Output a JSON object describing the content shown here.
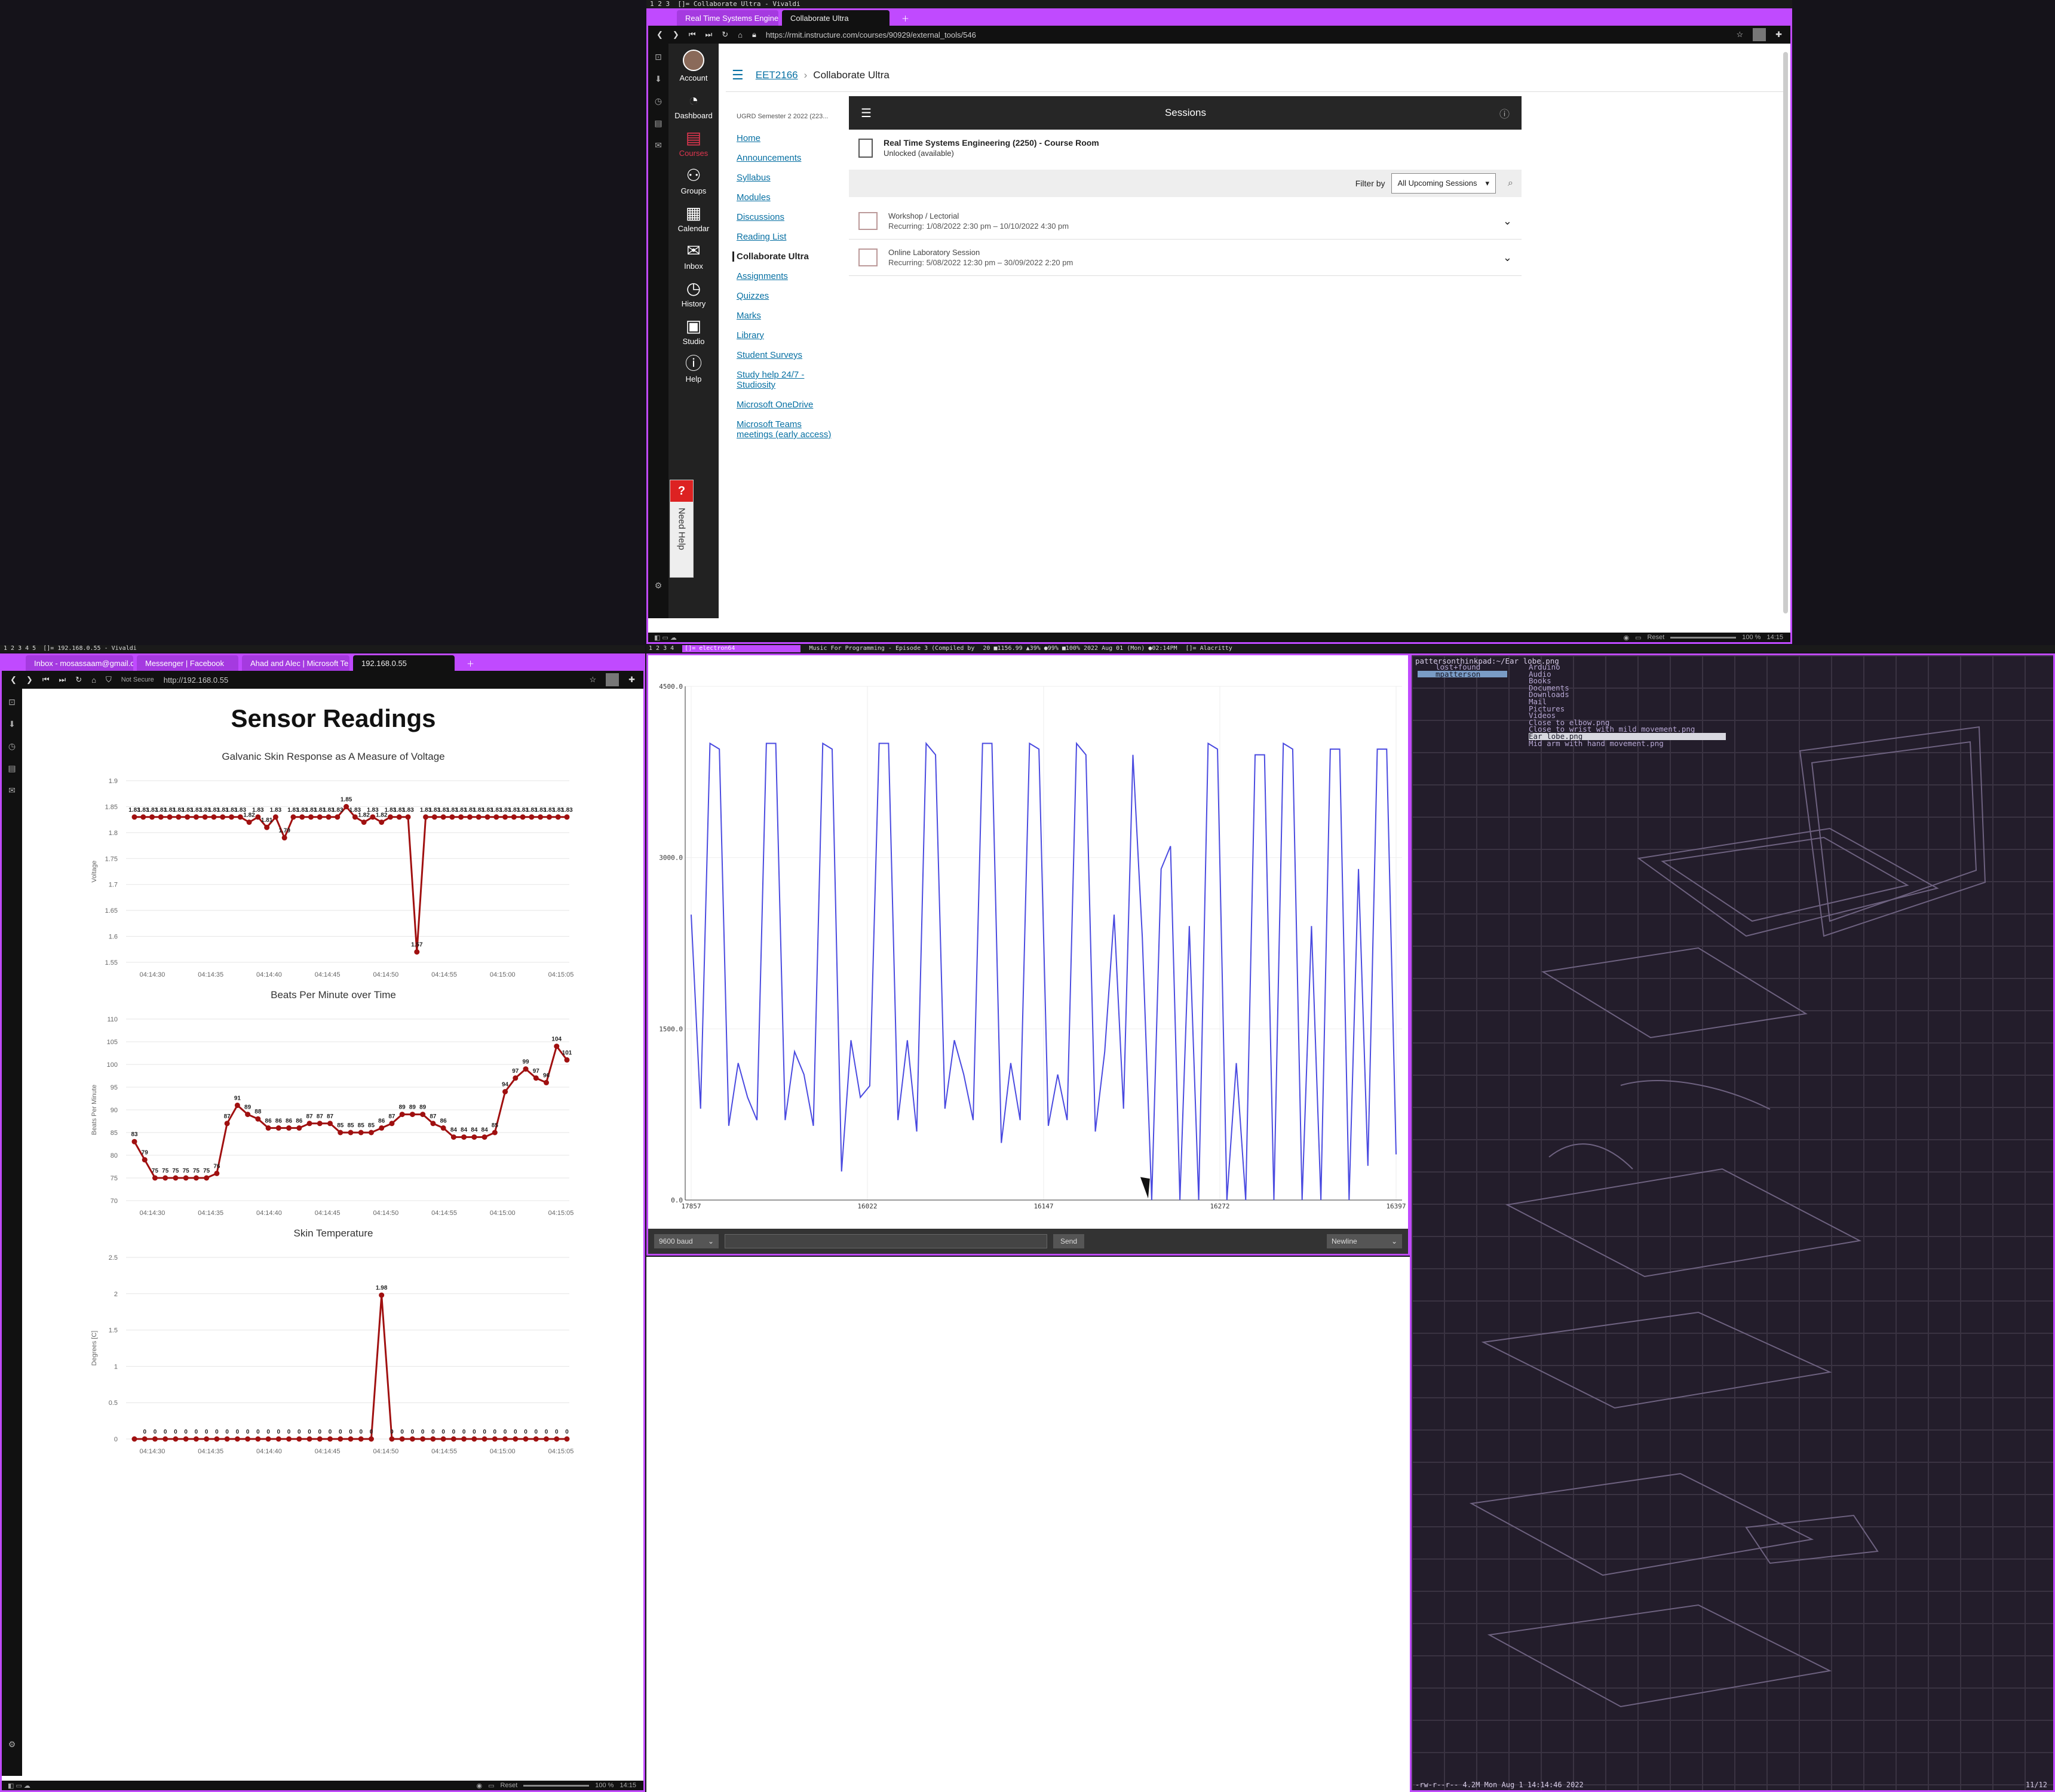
{
  "top_bar": {
    "workspaces": [
      "1",
      "2",
      "3"
    ],
    "title": "[]= Collaborate Ultra - Vivaldi"
  },
  "canvas_browser": {
    "tabs": [
      "Real Time Systems Engineer",
      "Collaborate Ultra"
    ],
    "url": "https://rmit.instructure.com/courses/90929/external_tools/546",
    "global_nav": [
      {
        "label": "Account",
        "icon": "account-icon"
      },
      {
        "label": "Dashboard",
        "icon": "dashboard-icon"
      },
      {
        "label": "Courses",
        "icon": "courses-icon"
      },
      {
        "label": "Groups",
        "icon": "groups-icon"
      },
      {
        "label": "Calendar",
        "icon": "calendar-icon"
      },
      {
        "label": "Inbox",
        "icon": "inbox-icon"
      },
      {
        "label": "History",
        "icon": "history-icon"
      },
      {
        "label": "Studio",
        "icon": "studio-icon"
      },
      {
        "label": "Help",
        "icon": "help-icon"
      }
    ],
    "need_help": "Need Help",
    "breadcrumb": {
      "course": "EET2166",
      "page": "Collaborate Ultra"
    },
    "term": "UGRD Semester 2 2022 (223...",
    "course_nav": [
      "Home",
      "Announcements",
      "Syllabus",
      "Modules",
      "Discussions",
      "Reading List",
      "Collaborate Ultra",
      "Assignments",
      "Quizzes",
      "Marks",
      "Library",
      "Student Surveys",
      "Study help 24/7 - Studiosity",
      "Microsoft OneDrive",
      "Microsoft Teams meetings (early access)"
    ],
    "sessions": {
      "title": "Sessions",
      "room_name": "Real Time Systems Engineering (2250) - Course Room",
      "room_status": "Unlocked (available)",
      "filter_label": "Filter by",
      "filter_value": "All Upcoming Sessions",
      "list": [
        {
          "name": "Workshop / Lectorial",
          "recurring": "Recurring: 1/08/2022 2:30 pm – 10/10/2022 4:30 pm"
        },
        {
          "name": "Online Laboratory Session",
          "recurring": "Recurring: 5/08/2022 12:30 pm – 30/09/2022 2:20 pm"
        }
      ]
    },
    "status": {
      "reset": "Reset",
      "zoom": "100 %",
      "time": "14:15"
    }
  },
  "left_bar": {
    "workspaces": [
      "1",
      "2",
      "3",
      "4",
      "5"
    ],
    "title": "[]= 192.168.0.55 - Vivaldi"
  },
  "sensor_browser": {
    "tabs": [
      "Inbox - mosassaam@gmail.c",
      "Messenger | Facebook",
      "Ahad and Alec | Microsoft Te",
      "192.168.0.55"
    ],
    "not_secure": "Not Secure",
    "url": "http://192.168.0.55",
    "page_title": "Sensor Readings",
    "status": {
      "reset": "Reset",
      "zoom": "100 %",
      "time": "14:15"
    }
  },
  "chart_data": [
    {
      "type": "line",
      "title": "Galvanic Skin Response as A Measure of Voltage",
      "ylabel": "Voltage",
      "ylim": [
        1.55,
        1.9
      ],
      "yticks": [
        "1.9",
        "1.85",
        "1.8",
        "1.75",
        "1.7",
        "1.65",
        "1.6",
        "1.55"
      ],
      "xticks": [
        "04:14:30",
        "04:14:35",
        "04:14:40",
        "04:14:45",
        "04:14:50",
        "04:14:55",
        "04:15:00",
        "04:15:05"
      ],
      "values": [
        1.83,
        1.83,
        1.83,
        1.83,
        1.83,
        1.83,
        1.83,
        1.83,
        1.83,
        1.83,
        1.83,
        1.83,
        1.83,
        1.82,
        1.83,
        1.81,
        1.83,
        1.79,
        1.83,
        1.83,
        1.83,
        1.83,
        1.83,
        1.83,
        1.85,
        1.83,
        1.82,
        1.83,
        1.82,
        1.83,
        1.83,
        1.83,
        1.57,
        1.83,
        1.83,
        1.83,
        1.83,
        1.83,
        1.83,
        1.83,
        1.83,
        1.83,
        1.83,
        1.83,
        1.83,
        1.83,
        1.83,
        1.83,
        1.83,
        1.83
      ]
    },
    {
      "type": "line",
      "title": "Beats Per Minute over Time",
      "ylabel": "Beats Per Minute",
      "ylim": [
        70,
        110
      ],
      "yticks": [
        "110",
        "105",
        "100",
        "95",
        "90",
        "85",
        "80",
        "75",
        "70"
      ],
      "xticks": [
        "04:14:30",
        "04:14:35",
        "04:14:40",
        "04:14:45",
        "04:14:50",
        "04:14:55",
        "04:15:00",
        "04:15:05"
      ],
      "values": [
        83,
        79,
        75,
        75,
        75,
        75,
        75,
        75,
        76,
        87,
        91,
        89,
        88,
        86,
        86,
        86,
        86,
        87,
        87,
        87,
        85,
        85,
        85,
        85,
        86,
        87,
        89,
        89,
        89,
        87,
        86,
        84,
        84,
        84,
        84,
        85,
        94,
        97,
        99,
        97,
        96,
        104,
        101
      ]
    },
    {
      "type": "line",
      "title": "Skin Temperature",
      "ylabel": "Degrees [C]",
      "ylim": [
        0,
        2.5
      ],
      "yticks": [
        "2.5",
        "2",
        "1.5",
        "1",
        "0.5",
        "0"
      ],
      "xticks": [
        "04:14:30",
        "04:14:35",
        "04:14:40",
        "04:14:45",
        "04:14:50",
        "04:14:55",
        "04:15:00",
        "04:15:05"
      ],
      "values": [
        0,
        0,
        0,
        0,
        0,
        0,
        0,
        0,
        0,
        0,
        0,
        0,
        0,
        0,
        0,
        0,
        0,
        0,
        0,
        0,
        0,
        0,
        0,
        0,
        1.98,
        0,
        0,
        0,
        0,
        0,
        0,
        0,
        0,
        0,
        0,
        0,
        0,
        0,
        0,
        0,
        0,
        0,
        0
      ]
    },
    {
      "type": "line",
      "title": "",
      "ylim": [
        0,
        4500
      ],
      "yticks": [
        "4500.0",
        "3000.0",
        "1500.0",
        "0.0"
      ],
      "xticks": [
        "17857",
        "16022",
        "16147",
        "16272",
        "16397"
      ],
      "values": [
        2500,
        800,
        4000,
        3950,
        650,
        1200,
        900,
        700,
        4000,
        4000,
        700,
        1300,
        1100,
        650,
        4000,
        3950,
        250,
        1400,
        900,
        1000,
        4000,
        4000,
        700,
        1400,
        600,
        4000,
        3900,
        800,
        1400,
        1100,
        700,
        4000,
        4000,
        500,
        1200,
        700,
        4000,
        3950,
        650,
        1100,
        700,
        4000,
        3900,
        600,
        1300,
        2500,
        800,
        3900,
        2300,
        0,
        2900,
        3100,
        0,
        2400,
        0,
        4000,
        3950,
        0,
        1200,
        0,
        3900,
        3900,
        0,
        4000,
        3950,
        0,
        2400,
        0,
        3950,
        3950,
        0,
        2900,
        300,
        3950,
        3950,
        400
      ]
    }
  ],
  "serial": {
    "baud": "9600 baud",
    "send": "Send",
    "newline": "Newline"
  },
  "middle_bar": {
    "workspaces": [
      "1",
      "2",
      "3",
      "4"
    ],
    "title": "[]= electron64",
    "music": "Music For Programming - Episode 3 (Compiled by",
    "stats": "20 ■1156.99 ▲39% ●99% ■100% 2022 Aug 01 (Mon) ●02:14PM",
    "right_title": "[]= Alacritty"
  },
  "terminal": {
    "header": "pattersonthinkpad:~/Ear lobe.png",
    "tree": [
      "lost+found",
      "mpatterson",
      "Arduino",
      "Audio",
      "Books",
      "Documents",
      "Downloads",
      "Mail",
      "Pictures",
      "Videos",
      "Close to elbow.png",
      "Close to wrist with mild movement.png",
      "Ear lobe.png",
      "Mid arm with hand movement.png"
    ],
    "status": "-rw-r--r-- 4.2M Mon Aug  1 14:14:46 2022",
    "corner": "11/12"
  }
}
